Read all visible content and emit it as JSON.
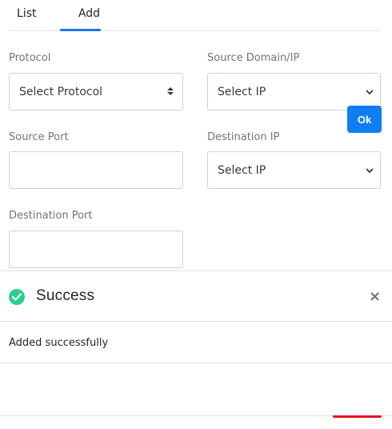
{
  "tabs": [
    {
      "label": "List"
    },
    {
      "label": "Add"
    }
  ],
  "form": {
    "protocol": {
      "label": "Protocol",
      "value": "Select Protocol"
    },
    "source_domain": {
      "label": "Source Domain/IP",
      "value": "Select IP"
    },
    "source_port": {
      "label": "Source Port",
      "value": ""
    },
    "destination_ip": {
      "label": "Destination IP",
      "value": "Select IP"
    },
    "destination_port": {
      "label": "Destination Port",
      "value": ""
    }
  },
  "modal": {
    "title": "Success",
    "message": "Added successfully",
    "ok_label": "Ok",
    "close_glyph": "×",
    "status_icon": "check-circle-icon"
  },
  "colors": {
    "accent": "#1a73e8",
    "success": "#2ecc8f",
    "primary_button": "#0d7ff2",
    "danger_edge": "#e8101a"
  }
}
